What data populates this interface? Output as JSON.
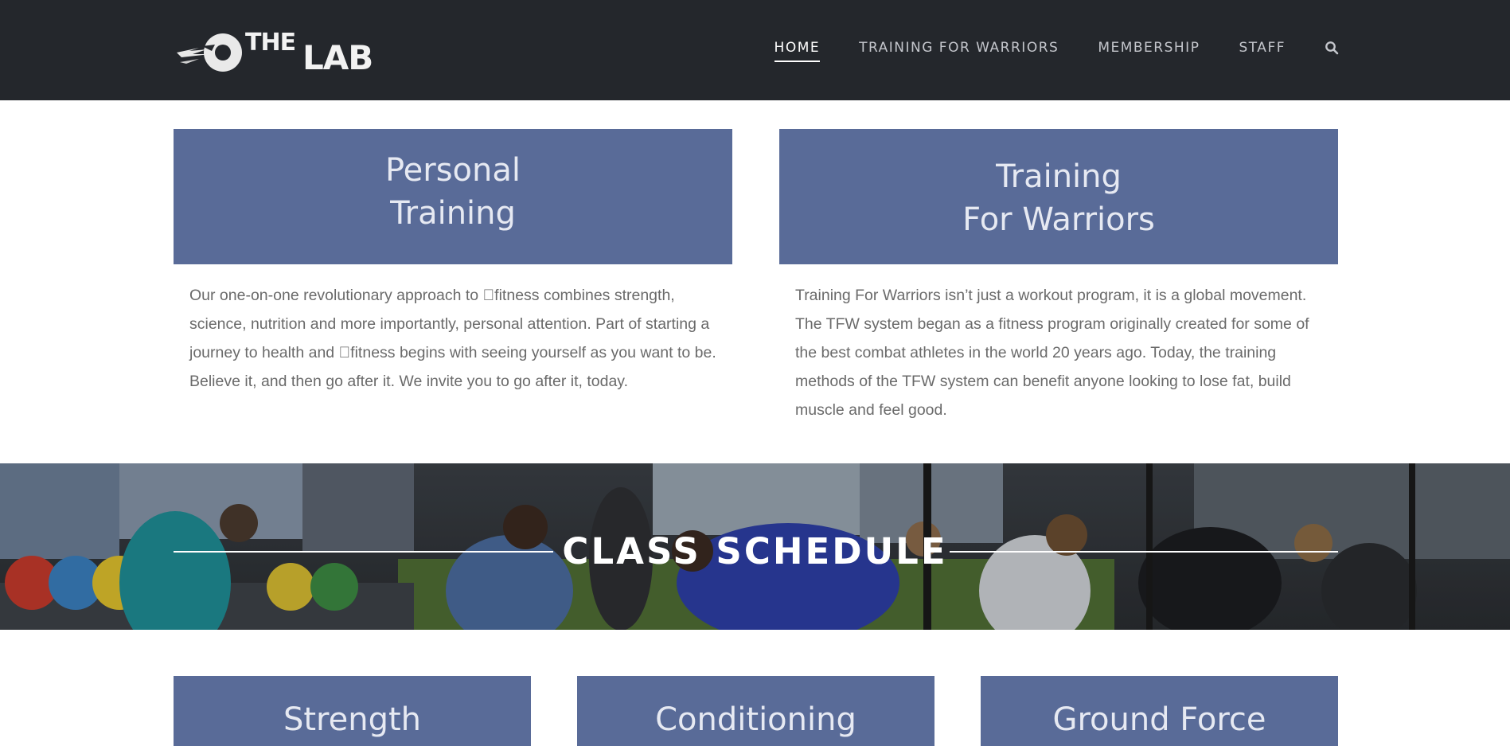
{
  "header": {
    "logo": {
      "word1": "THE",
      "word2": "LAB"
    },
    "nav": [
      {
        "label": "HOME",
        "active": true
      },
      {
        "label": "TRAINING FOR WARRIORS",
        "active": false
      },
      {
        "label": "MEMBERSHIP",
        "active": false
      },
      {
        "label": "STAFF",
        "active": false
      }
    ],
    "search_icon": "search-icon"
  },
  "services": [
    {
      "title_line1": "Personal",
      "title_line2": "Training",
      "text": "Our one-on-one revolutionary approach to ￿fitness combines strength, science, nutrition and more importantly, personal attention. Part of starting a journey to health and ￿fitness begins with seeing yourself as you want to be. Believe it, and then go after it. We invite you to go after it, today."
    },
    {
      "title_line1": "Training",
      "title_line2": "For Warriors",
      "text": "Training For Warriors isn’t just a workout program, it is a global movement. The TFW system began as a fitness program originally created for some of the best combat athletes in the world 20 years ago. Today, the training methods of the TFW system can benefit anyone looking to lose fat, build muscle and feel good."
    }
  ],
  "banner": {
    "title": "CLASS SCHEDULE"
  },
  "classes": [
    {
      "title": "Strength"
    },
    {
      "title": "Conditioning"
    },
    {
      "title": "Ground Force"
    }
  ],
  "colors": {
    "header_bg": "#24272c",
    "box_bg": "#596b98",
    "box_text": "#e6e9f2",
    "body_text": "#6a6a6a"
  }
}
